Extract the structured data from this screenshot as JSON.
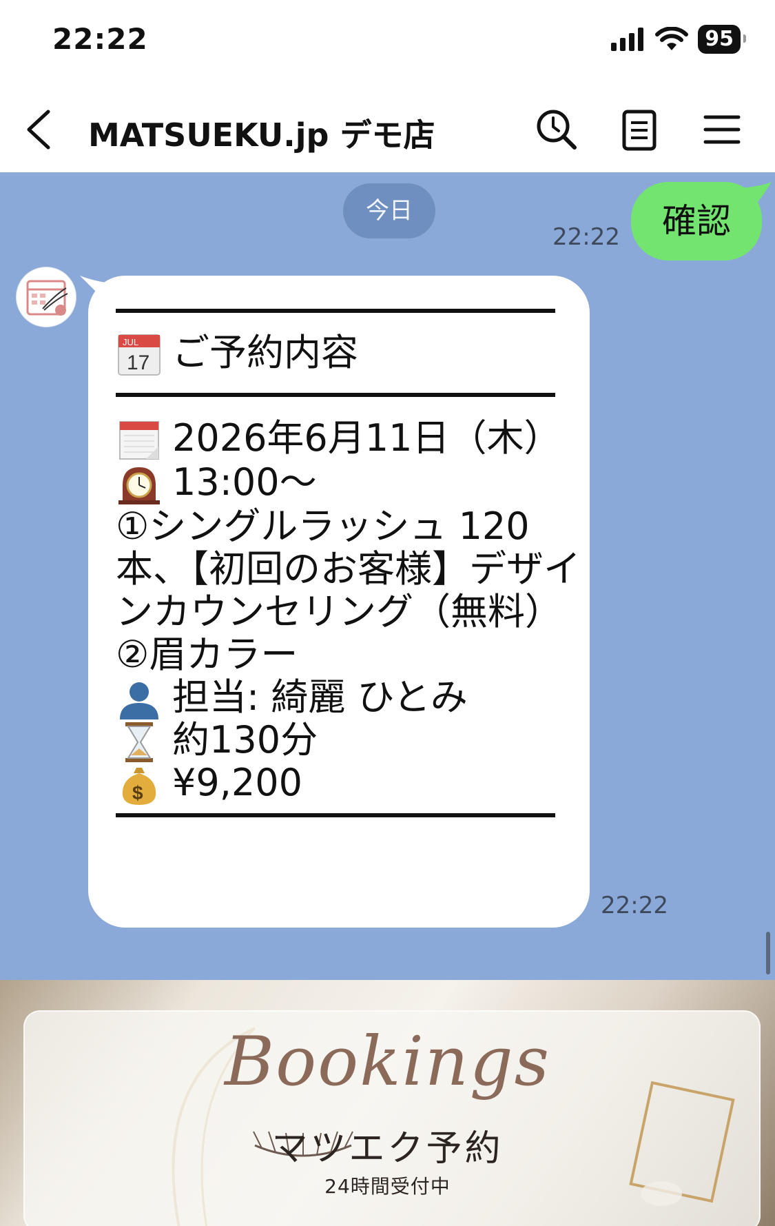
{
  "status_bar": {
    "time": "22:22",
    "battery": "95"
  },
  "header": {
    "title": "MATSUEKU.jp デモ店"
  },
  "chat": {
    "date_chip": "今日",
    "sent_message": {
      "text": "確認",
      "time": "22:22"
    },
    "received_message": {
      "heading": "ご予約内容",
      "date": "2026年6月11日（木）",
      "start_time": "13:00～",
      "menu_lines": [
        "①シングルラッシュ 120",
        "本、【初回のお客様】デザイ",
        "ンカウンセリング（無料）",
        "②眉カラー"
      ],
      "staff": "担当: 綺麗 ひとみ",
      "duration": "約130分",
      "price": "¥9,200",
      "time": "22:22",
      "calendar_icon_month": "JUL",
      "calendar_icon_day": "17"
    }
  },
  "rich_menu": {
    "script": "Bookings",
    "title": "マツエク予約",
    "subtitle": "24時間受付中"
  },
  "colors": {
    "chat_background": "#8aa9d9",
    "sent_bubble": "#72e46f",
    "date_chip": "#6e8fbf"
  },
  "icons": [
    "back-icon",
    "search-icon",
    "notes-icon",
    "menu-icon",
    "calendar-emoji",
    "tear-off-calendar-emoji",
    "clock-emoji",
    "person-emoji",
    "hourglass-emoji",
    "money-bag-emoji"
  ]
}
